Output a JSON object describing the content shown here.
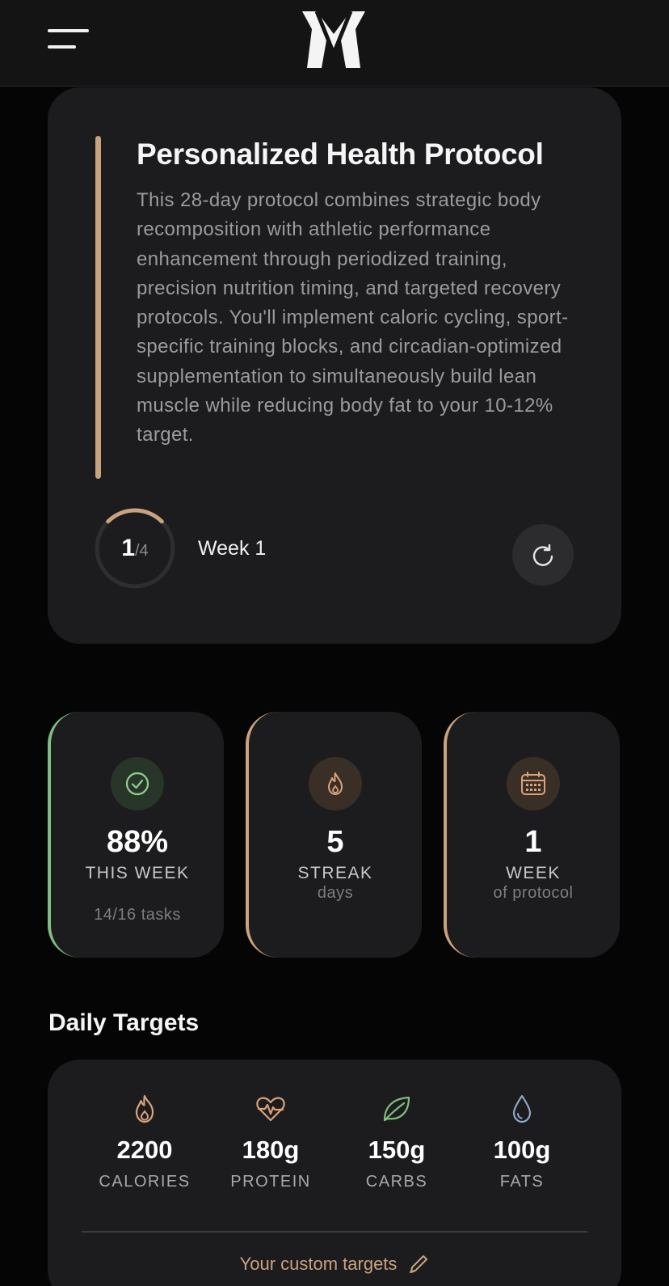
{
  "header": {
    "menu_icon": "hamburger-menu-icon",
    "logo_icon": "brand-logo-icon"
  },
  "protocol": {
    "title": "Personalized Health Protocol",
    "description": "This 28-day protocol combines strategic body recomposition with athletic performance enhancement through periodized training, precision nutrition timing, and targeted recovery protocols. You'll implement caloric cycling, sport-specific training blocks, and circadian-optimized supplementation to simultaneously build lean muscle while reducing body fat to your 10-12% target.",
    "progress_current": "1",
    "progress_total": "/4",
    "progress_fraction": 0.25,
    "week_label": "Week 1",
    "refresh_icon": "refresh-icon",
    "accent_color": "#c9a27e"
  },
  "stats": [
    {
      "icon": "check-circle-icon",
      "value": "88%",
      "label": "THIS WEEK",
      "sub": "14/16 tasks",
      "accent": "#7fbf7f"
    },
    {
      "icon": "flame-icon",
      "value": "5",
      "label": "STREAK",
      "sub": "days",
      "accent": "#c9a27e"
    },
    {
      "icon": "calendar-icon",
      "value": "1",
      "label": "WEEK",
      "sub": "of protocol",
      "accent": "#c9a27e"
    }
  ],
  "daily_targets": {
    "title": "Daily Targets",
    "items": [
      {
        "icon": "flame-icon",
        "value": "2200",
        "label": "CALORIES",
        "color": "#d9a27a"
      },
      {
        "icon": "heart-pulse-icon",
        "value": "180g",
        "label": "PROTEIN",
        "color": "#d9a27a"
      },
      {
        "icon": "leaf-icon",
        "value": "150g",
        "label": "CARBS",
        "color": "#7fbf7f"
      },
      {
        "icon": "droplet-icon",
        "value": "100g",
        "label": "FATS",
        "color": "#8fa8c8"
      }
    ],
    "custom_link": "Your custom targets",
    "custom_icon": "pencil-icon"
  }
}
